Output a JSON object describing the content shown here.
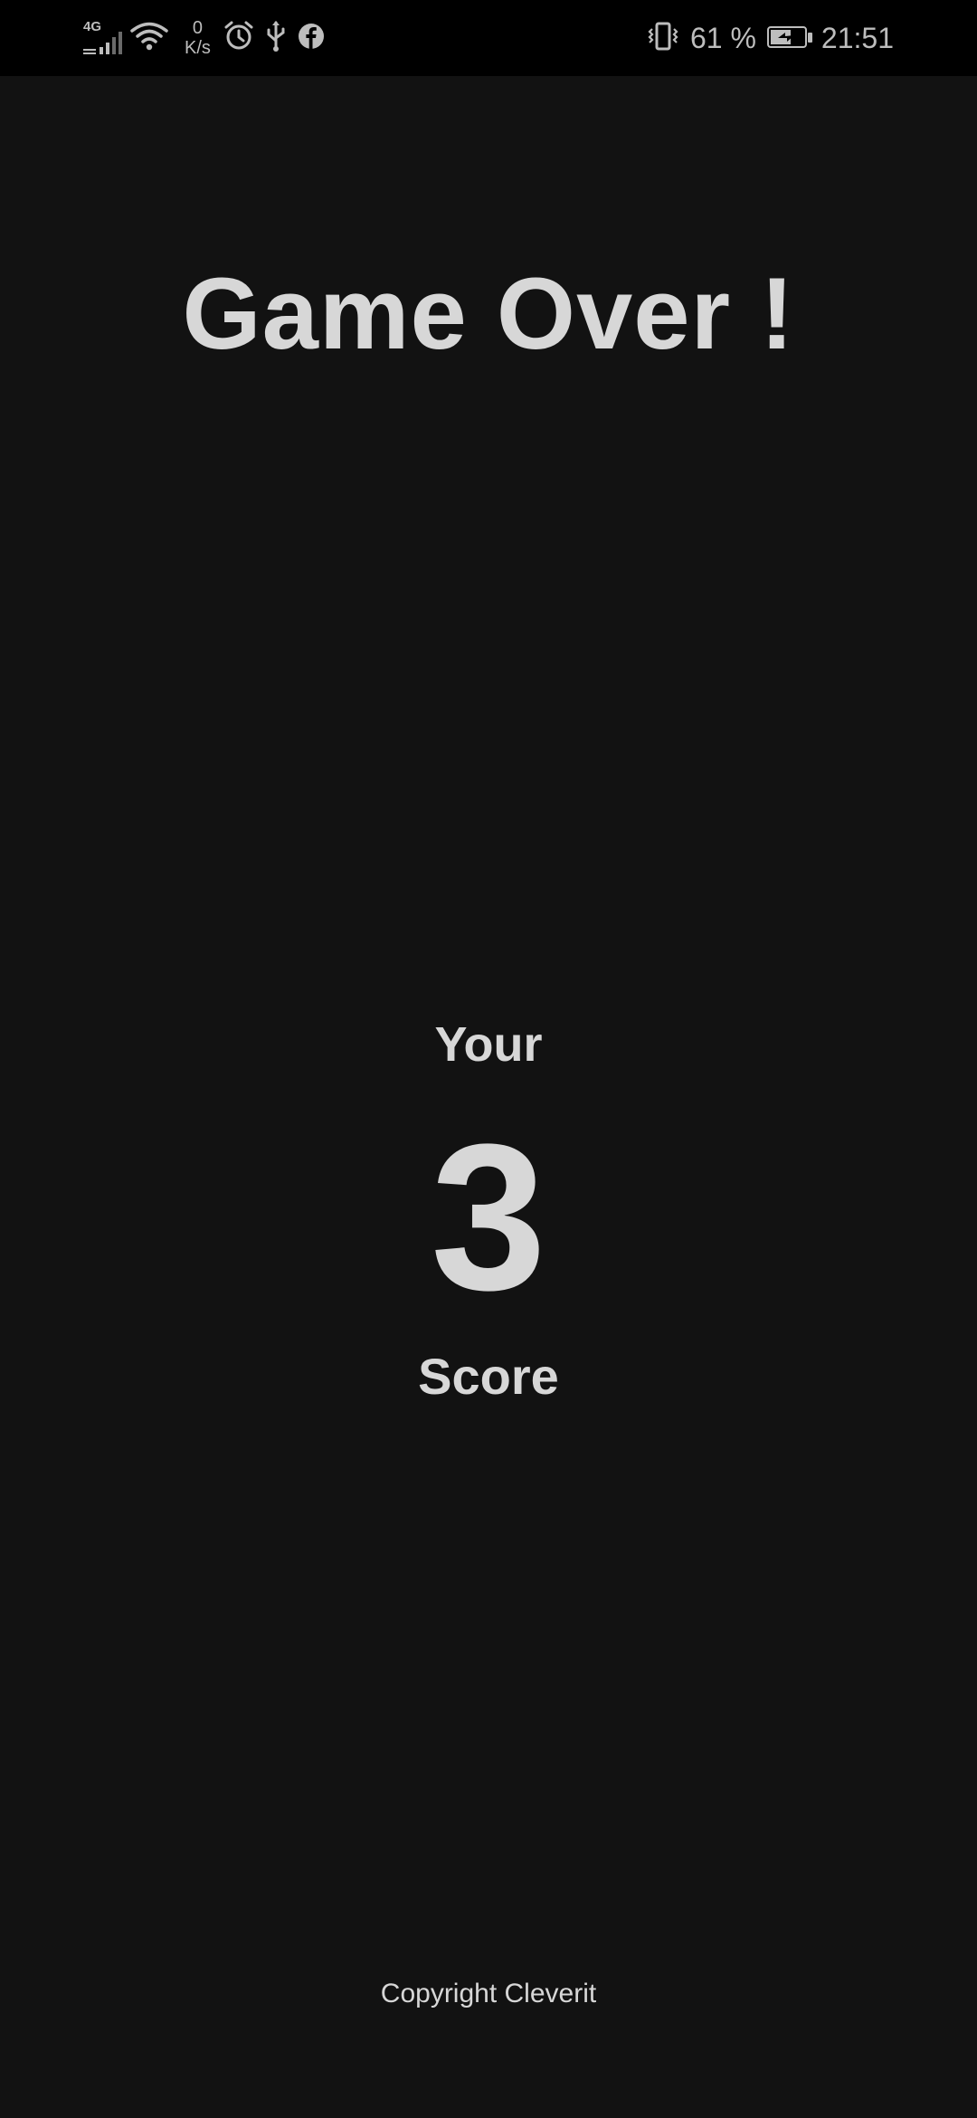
{
  "status_bar": {
    "network_type": "4G",
    "speed_value": "0",
    "speed_unit": "K/s",
    "battery_percent_text": "61 %",
    "battery_level": 0.61,
    "time": "21:51",
    "icons": [
      "signal-icon",
      "wifi-icon",
      "alarm-icon",
      "usb-icon",
      "facebook-icon",
      "vibrate-icon",
      "battery-charging-icon"
    ]
  },
  "game_over": {
    "title": "Game Over !",
    "your_label": "Your",
    "score_value": "3",
    "score_label": "Score",
    "copyright": "Copyright Cleverit"
  },
  "colors": {
    "background": "#121212",
    "status_bar": "#000000",
    "text": "#d7d7d7",
    "status_text": "#bdbdbd"
  }
}
